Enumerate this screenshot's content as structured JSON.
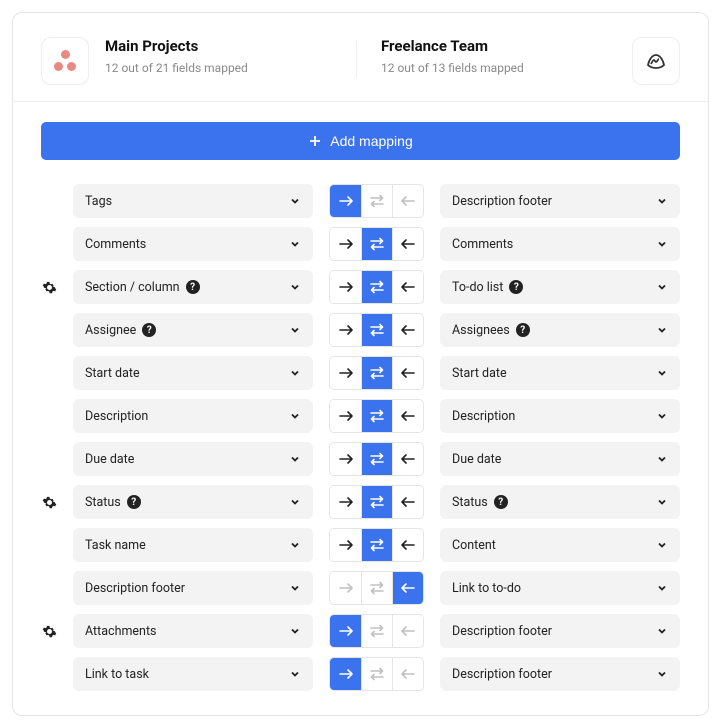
{
  "header": {
    "left": {
      "title": "Main Projects",
      "subtitle": "12 out of 21 fields mapped"
    },
    "right": {
      "title": "Freelance Team",
      "subtitle": "12 out of 13 fields mapped"
    }
  },
  "add_button": "Add mapping",
  "rows": [
    {
      "gear": false,
      "left": {
        "label": "Tags",
        "info": false
      },
      "dir": "right",
      "right": {
        "label": "Description footer",
        "info": false
      }
    },
    {
      "gear": false,
      "left": {
        "label": "Comments",
        "info": false
      },
      "dir": "both",
      "right": {
        "label": "Comments",
        "info": false
      }
    },
    {
      "gear": true,
      "left": {
        "label": "Section / column",
        "info": true
      },
      "dir": "both",
      "right": {
        "label": "To-do list",
        "info": true
      }
    },
    {
      "gear": false,
      "left": {
        "label": "Assignee",
        "info": true
      },
      "dir": "both",
      "right": {
        "label": "Assignees",
        "info": true
      }
    },
    {
      "gear": false,
      "left": {
        "label": "Start date",
        "info": false
      },
      "dir": "both",
      "right": {
        "label": "Start date",
        "info": false
      }
    },
    {
      "gear": false,
      "left": {
        "label": "Description",
        "info": false
      },
      "dir": "both",
      "right": {
        "label": "Description",
        "info": false
      }
    },
    {
      "gear": false,
      "left": {
        "label": "Due date",
        "info": false
      },
      "dir": "both",
      "right": {
        "label": "Due date",
        "info": false
      }
    },
    {
      "gear": true,
      "left": {
        "label": "Status",
        "info": true
      },
      "dir": "both",
      "right": {
        "label": "Status",
        "info": true
      }
    },
    {
      "gear": false,
      "left": {
        "label": "Task name",
        "info": false
      },
      "dir": "both",
      "right": {
        "label": "Content",
        "info": false
      }
    },
    {
      "gear": false,
      "left": {
        "label": "Description footer",
        "info": false
      },
      "dir": "left",
      "right": {
        "label": "Link to to-do",
        "info": false
      }
    },
    {
      "gear": true,
      "left": {
        "label": "Attachments",
        "info": false
      },
      "dir": "right",
      "right": {
        "label": "Description footer",
        "info": false
      }
    },
    {
      "gear": false,
      "left": {
        "label": "Link to task",
        "info": false
      },
      "dir": "right",
      "right": {
        "label": "Description footer",
        "info": false
      }
    }
  ]
}
